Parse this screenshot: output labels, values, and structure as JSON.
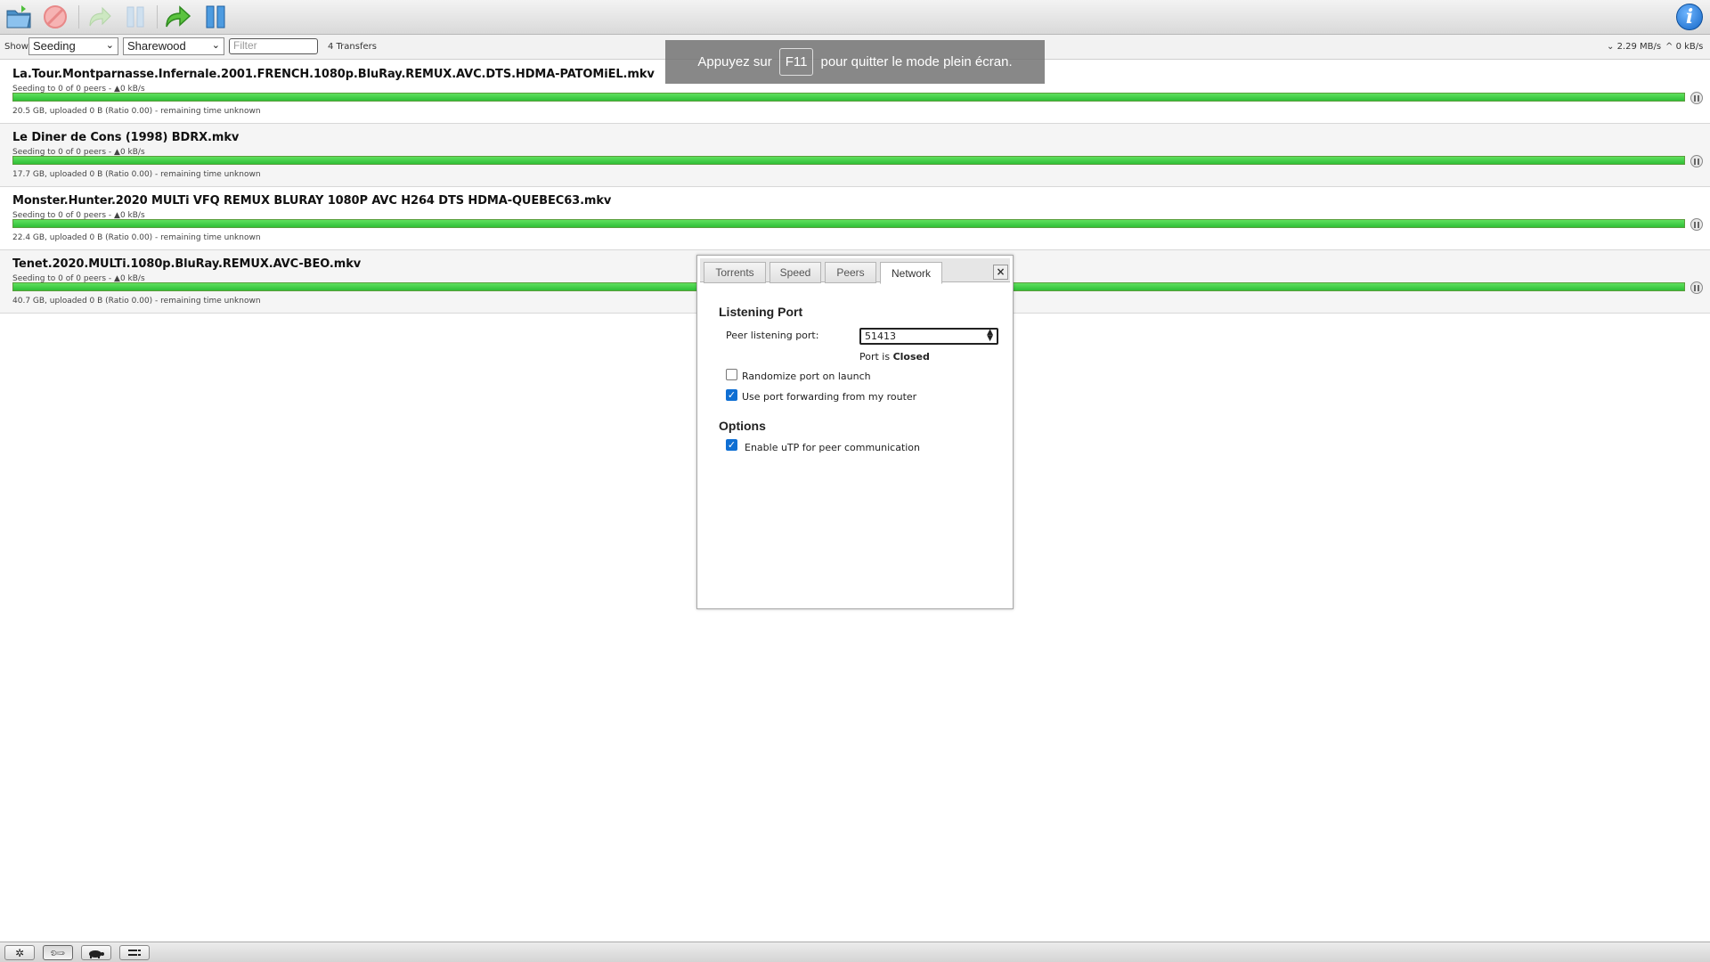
{
  "toolbar": {
    "buttons": [
      "open-icon",
      "remove-icon",
      "resume-selected-icon",
      "pause-selected-icon",
      "resume-all-icon",
      "pause-all-icon"
    ],
    "info_label": "i"
  },
  "filterbar": {
    "show_label": "Show",
    "state_filter": "Seeding",
    "tracker_filter": "Sharewood",
    "filter_placeholder": "Filter",
    "transfers_count": "4 Transfers",
    "download_speed": "2.29 MB/s",
    "upload_speed": "0 kB/s"
  },
  "toast": {
    "prefix": "Appuyez sur",
    "key": "F11",
    "suffix": "pour quitter le mode plein écran."
  },
  "torrents": [
    {
      "name": "La.Tour.Montparnasse.Infernale.2001.FRENCH.1080p.BluRay.REMUX.AVC.DTS.HDMA-PATOMiEL.mkv",
      "peers": "Seeding to 0 of 0 peers - ▲0 kB/s",
      "progress": "20.5 GB, uploaded 0 B (Ratio 0.00) - remaining time unknown",
      "percent": 100
    },
    {
      "name": "Le Diner de Cons (1998) BDRX.mkv",
      "peers": "Seeding to 0 of 0 peers - ▲0 kB/s",
      "progress": "17.7 GB, uploaded 0 B (Ratio 0.00) - remaining time unknown",
      "percent": 100
    },
    {
      "name": "Monster.Hunter.2020 MULTi VFQ REMUX BLURAY 1080P AVC H264 DTS HDMA-QUEBEC63.mkv",
      "peers": "Seeding to 0 of 0 peers - ▲0 kB/s",
      "progress": "22.4 GB, uploaded 0 B (Ratio 0.00) - remaining time unknown",
      "percent": 100
    },
    {
      "name": "Tenet.2020.MULTi.1080p.BluRay.REMUX.AVC-BEO.mkv",
      "peers": "Seeding to 0 of 0 peers - ▲0 kB/s",
      "progress": "40.7 GB, uploaded 0 B (Ratio 0.00) - remaining time unknown",
      "percent": 100
    }
  ],
  "dialog": {
    "tabs": [
      "Torrents",
      "Speed",
      "Peers",
      "Network"
    ],
    "active_tab": "Network",
    "close_label": "×",
    "listening_port_heading": "Listening Port",
    "peer_port_label": "Peer listening port:",
    "peer_port_value": "51413",
    "port_status_prefix": "Port is",
    "port_status": "Closed",
    "randomize_label": "Randomize port on launch",
    "randomize_checked": false,
    "port_forwarding_label": "Use port forwarding from my router",
    "port_forwarding_checked": true,
    "options_heading": "Options",
    "utp_label": "Enable uTP for peer communication",
    "utp_checked": true
  },
  "bottombar": {
    "buttons": [
      "settings-icon",
      "preferences-icon",
      "turtle-icon",
      "compact-view-icon"
    ]
  }
}
